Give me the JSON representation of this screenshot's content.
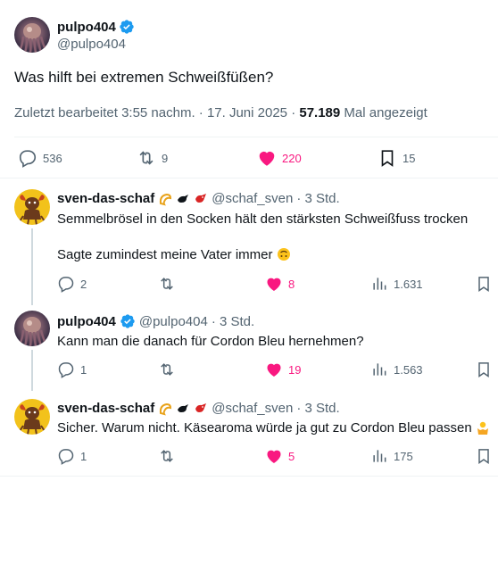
{
  "main_tweet": {
    "author_name": "pulpo404",
    "author_handle": "@pulpo404",
    "text": "Was hilft bei extremen Schweißfüßen?",
    "edited_label": "Zuletzt bearbeitet 3:55 nachm. · 17. Juni 2025 · ",
    "views_count": "57.189",
    "views_label": " Mal angezeigt",
    "replies": "536",
    "reposts": "9",
    "likes": "220",
    "bookmarks": "15"
  },
  "replies": [
    {
      "author_name": "sven-das-schaf",
      "author_handle": "@schaf_sven",
      "time": "· 3 Std.",
      "text_line1": "Semmelbrösel in den Socken hält den stärksten Schweißfuss trocken",
      "text_line2": "Sagte zumindest meine Vater immer",
      "replies": "2",
      "likes": "8",
      "views": "1.631"
    },
    {
      "author_name": "pulpo404",
      "author_handle": "@pulpo404",
      "time": "· 3 Std.",
      "text_line1": "Kann man die danach für Cordon Bleu hernehmen?",
      "replies": "1",
      "likes": "19",
      "views": "1.563"
    },
    {
      "author_name": "sven-das-schaf",
      "author_handle": "@schaf_sven",
      "time": "· 3 Std.",
      "text_line1": "Sicher. Warum nicht. Käsearoma würde ja gut zu Cordon Bleu passen",
      "replies": "1",
      "likes": "5",
      "views": "175"
    }
  ],
  "colors": {
    "like": "#f91880",
    "verified": "#1d9bf0",
    "muted": "#536471",
    "text": "#0f1419"
  }
}
